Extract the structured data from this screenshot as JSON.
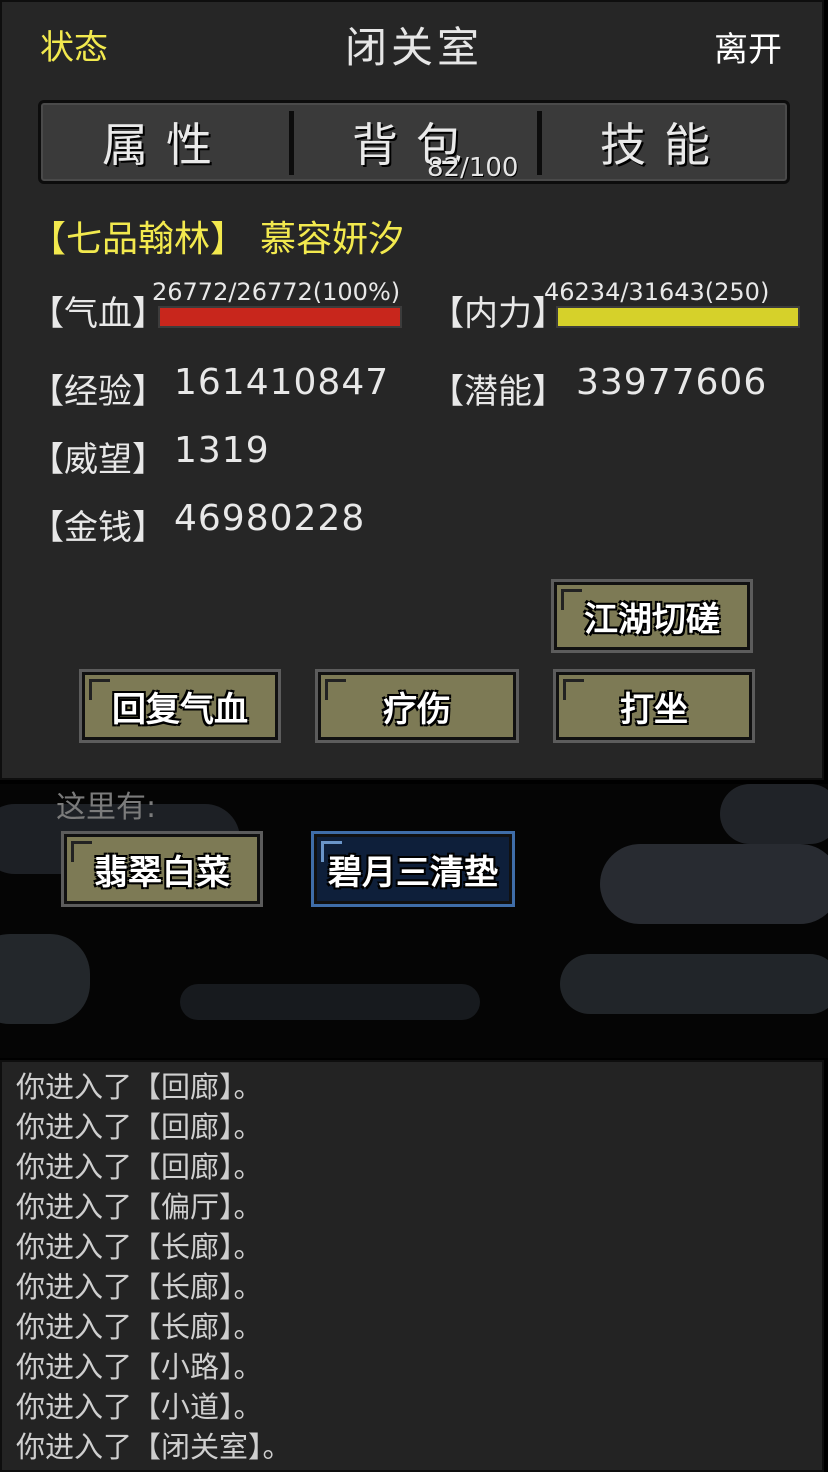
{
  "header": {
    "status": "状态",
    "title": "闭关室",
    "exit": "离开"
  },
  "tabs": {
    "attributes": "属性",
    "bag": "背包",
    "bag_count": "82/100",
    "skills": "技能"
  },
  "character": {
    "rank": "【七品翰林】",
    "name": "慕容妍汐"
  },
  "stats": {
    "hp_label": "【气血】",
    "hp_text": "26772/26772(100%)",
    "hp_fraction": 1.0,
    "mp_label": "【内力】",
    "mp_text": "46234/31643(250)",
    "mp_fraction": 1.0,
    "exp_label": "【经验】",
    "exp": "161410847",
    "potential_label": "【潜能】",
    "potential": "33977606",
    "prestige_label": "【威望】",
    "prestige": "1319",
    "money_label": "【金钱】",
    "money": "46980228"
  },
  "colors": {
    "hp_bar": "#c8261c",
    "mp_bar": "#d6d12a",
    "accent_text": "#f2e94e"
  },
  "actions": {
    "spar": "江湖切磋",
    "restore_hp": "回复气血",
    "heal": "疗伤",
    "meditate": "打坐"
  },
  "scene": {
    "here_label": "这里有:",
    "items": [
      "翡翠白菜",
      "碧月三清垫"
    ]
  },
  "log": [
    "你进入了【回廊】。",
    "你进入了【回廊】。",
    "你进入了【回廊】。",
    "你进入了【偏厅】。",
    "你进入了【长廊】。",
    "你进入了【长廊】。",
    "你进入了【长廊】。",
    "你进入了【小路】。",
    "你进入了【小道】。",
    "你进入了【闭关室】。"
  ]
}
